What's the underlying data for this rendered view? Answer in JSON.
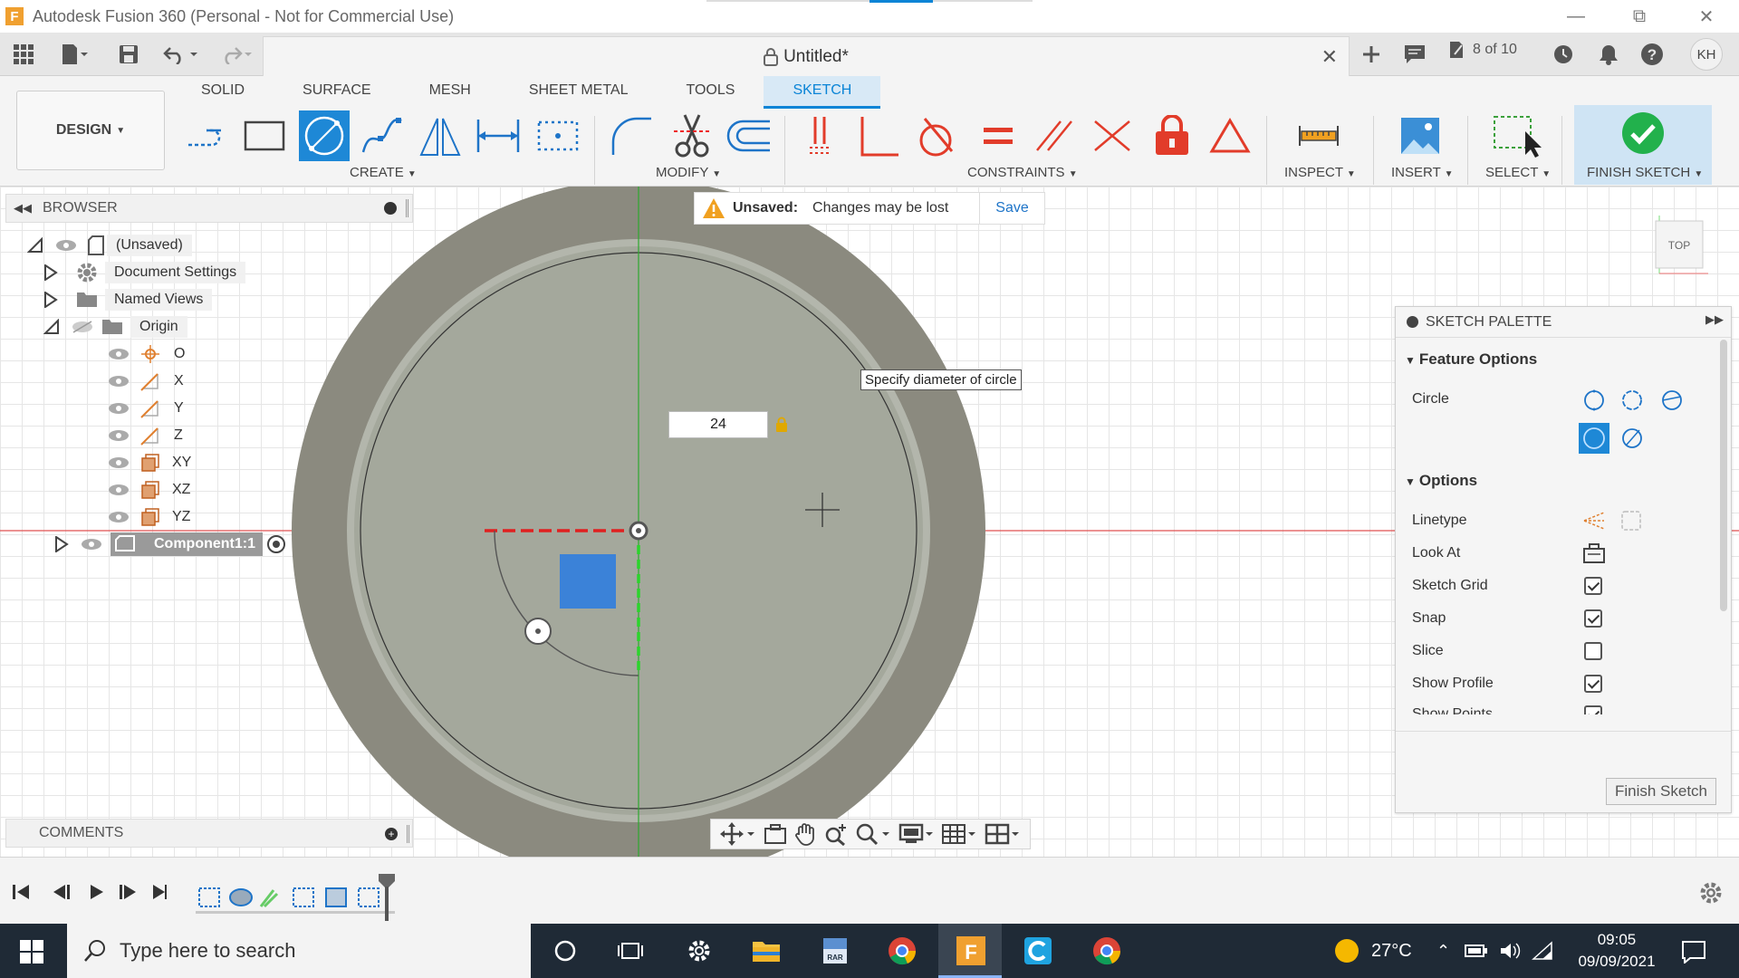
{
  "window": {
    "app_title": "Autodesk Fusion 360 (Personal - Not for Commercial Use)",
    "logo_letter": "F"
  },
  "quick_access": {
    "doc_title": "Untitled*",
    "job_status": "8 of 10",
    "user_initials": "KH"
  },
  "ribbon": {
    "tabs": [
      {
        "label": "SOLID",
        "active": false
      },
      {
        "label": "SURFACE",
        "active": false
      },
      {
        "label": "MESH",
        "active": false
      },
      {
        "label": "SHEET METAL",
        "active": false
      },
      {
        "label": "TOOLS",
        "active": false
      },
      {
        "label": "SKETCH",
        "active": true
      }
    ],
    "workspace": "DESIGN",
    "groups": {
      "create": "CREATE",
      "modify": "MODIFY",
      "constraints": "CONSTRAINTS",
      "inspect": "INSPECT",
      "insert": "INSERT",
      "select": "SELECT",
      "finish": "FINISH SKETCH"
    }
  },
  "browser": {
    "title": "BROWSER",
    "root": "(Unsaved)",
    "document_settings": "Document Settings",
    "named_views": "Named Views",
    "origin": "Origin",
    "origin_items": [
      "O",
      "X",
      "Y",
      "Z",
      "XY",
      "XZ",
      "YZ"
    ],
    "component": "Component1:1"
  },
  "notification": {
    "title": "Unsaved:",
    "message": "Changes may be lost",
    "action": "Save"
  },
  "canvas": {
    "tooltip": "Specify diameter of circle",
    "dimension_value": "24",
    "viewcube_label": "TOP"
  },
  "comments": {
    "title": "COMMENTS"
  },
  "palette": {
    "title": "SKETCH PALETTE",
    "feature_options": "Feature Options",
    "circle_label": "Circle",
    "options": "Options",
    "rows": [
      {
        "label": "Linetype"
      },
      {
        "label": "Look At"
      },
      {
        "label": "Sketch Grid",
        "checked": true
      },
      {
        "label": "Snap",
        "checked": true
      },
      {
        "label": "Slice",
        "checked": false
      },
      {
        "label": "Show Profile",
        "checked": true
      },
      {
        "label": "Show Points",
        "checked": true
      }
    ],
    "finish_button": "Finish Sketch"
  },
  "taskbar": {
    "search_placeholder": "Type here to search",
    "temperature": "27°C",
    "time": "09:05",
    "date": "09/09/2021"
  },
  "colors": {
    "accent": "#1e88d6",
    "model_body": "#8b8a7f",
    "sketch_face": "#a4a89c",
    "finish_green": "#22b14c"
  }
}
